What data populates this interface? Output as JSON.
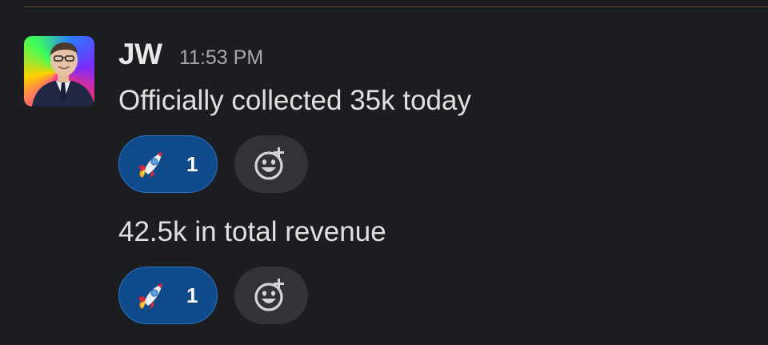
{
  "colors": {
    "background": "#1b1d21",
    "reaction_bg": "#0f4a8a",
    "reaction_border": "#2d73c4",
    "add_reaction_bg": "#313337",
    "text": "#e0e0e0",
    "timestamp": "#a7a9ac"
  },
  "message": {
    "author": "JW",
    "timestamp": "11:53 PM",
    "avatar_icon": "profile-photo",
    "blocks": [
      {
        "text": "Officially collected 35k today",
        "reaction": {
          "emoji_icon": "rocket-icon",
          "count": "1"
        },
        "add_reaction_icon": "add-reaction-icon"
      },
      {
        "text": "42.5k in total revenue",
        "reaction": {
          "emoji_icon": "rocket-icon",
          "count": "1"
        },
        "add_reaction_icon": "add-reaction-icon"
      }
    ]
  }
}
